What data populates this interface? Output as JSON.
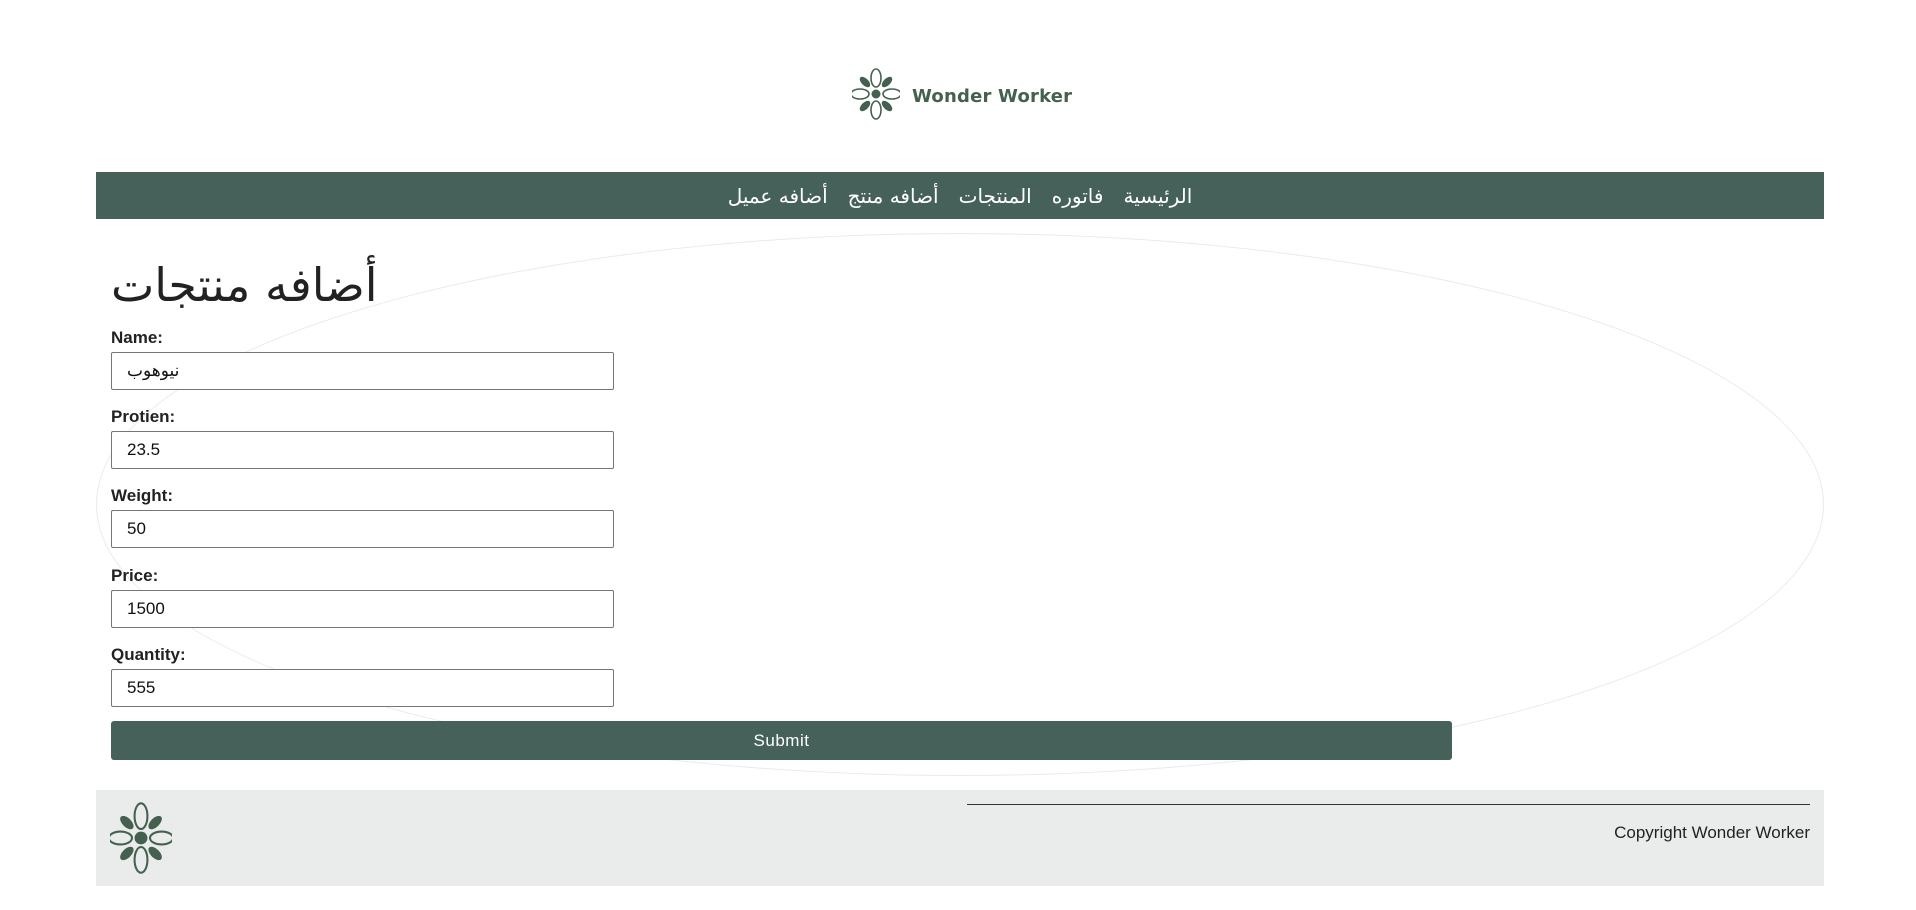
{
  "header": {
    "brand": "Wonder Worker",
    "logo_icon": "flower-logo-icon"
  },
  "nav": {
    "items": [
      {
        "label": "الرئيسية"
      },
      {
        "label": "فاتوره"
      },
      {
        "label": "المنتجات"
      },
      {
        "label": "أضافه منتج"
      },
      {
        "label": "أضافه عميل"
      }
    ]
  },
  "form": {
    "title": "أضافه منتجات",
    "fields": [
      {
        "label": "Name:",
        "value": "نيوهوب"
      },
      {
        "label": "Protien:",
        "value": "23.5"
      },
      {
        "label": "Weight:",
        "value": "50"
      },
      {
        "label": "Price:",
        "value": "1500"
      },
      {
        "label": "Quantity:",
        "value": "555"
      }
    ],
    "submit_label": "Submit"
  },
  "footer": {
    "copyright": "Copyright Wonder Worker",
    "logo_icon": "flower-logo-icon"
  },
  "colors": {
    "primary": "#45615a",
    "footer_bg": "#eaeceb"
  }
}
